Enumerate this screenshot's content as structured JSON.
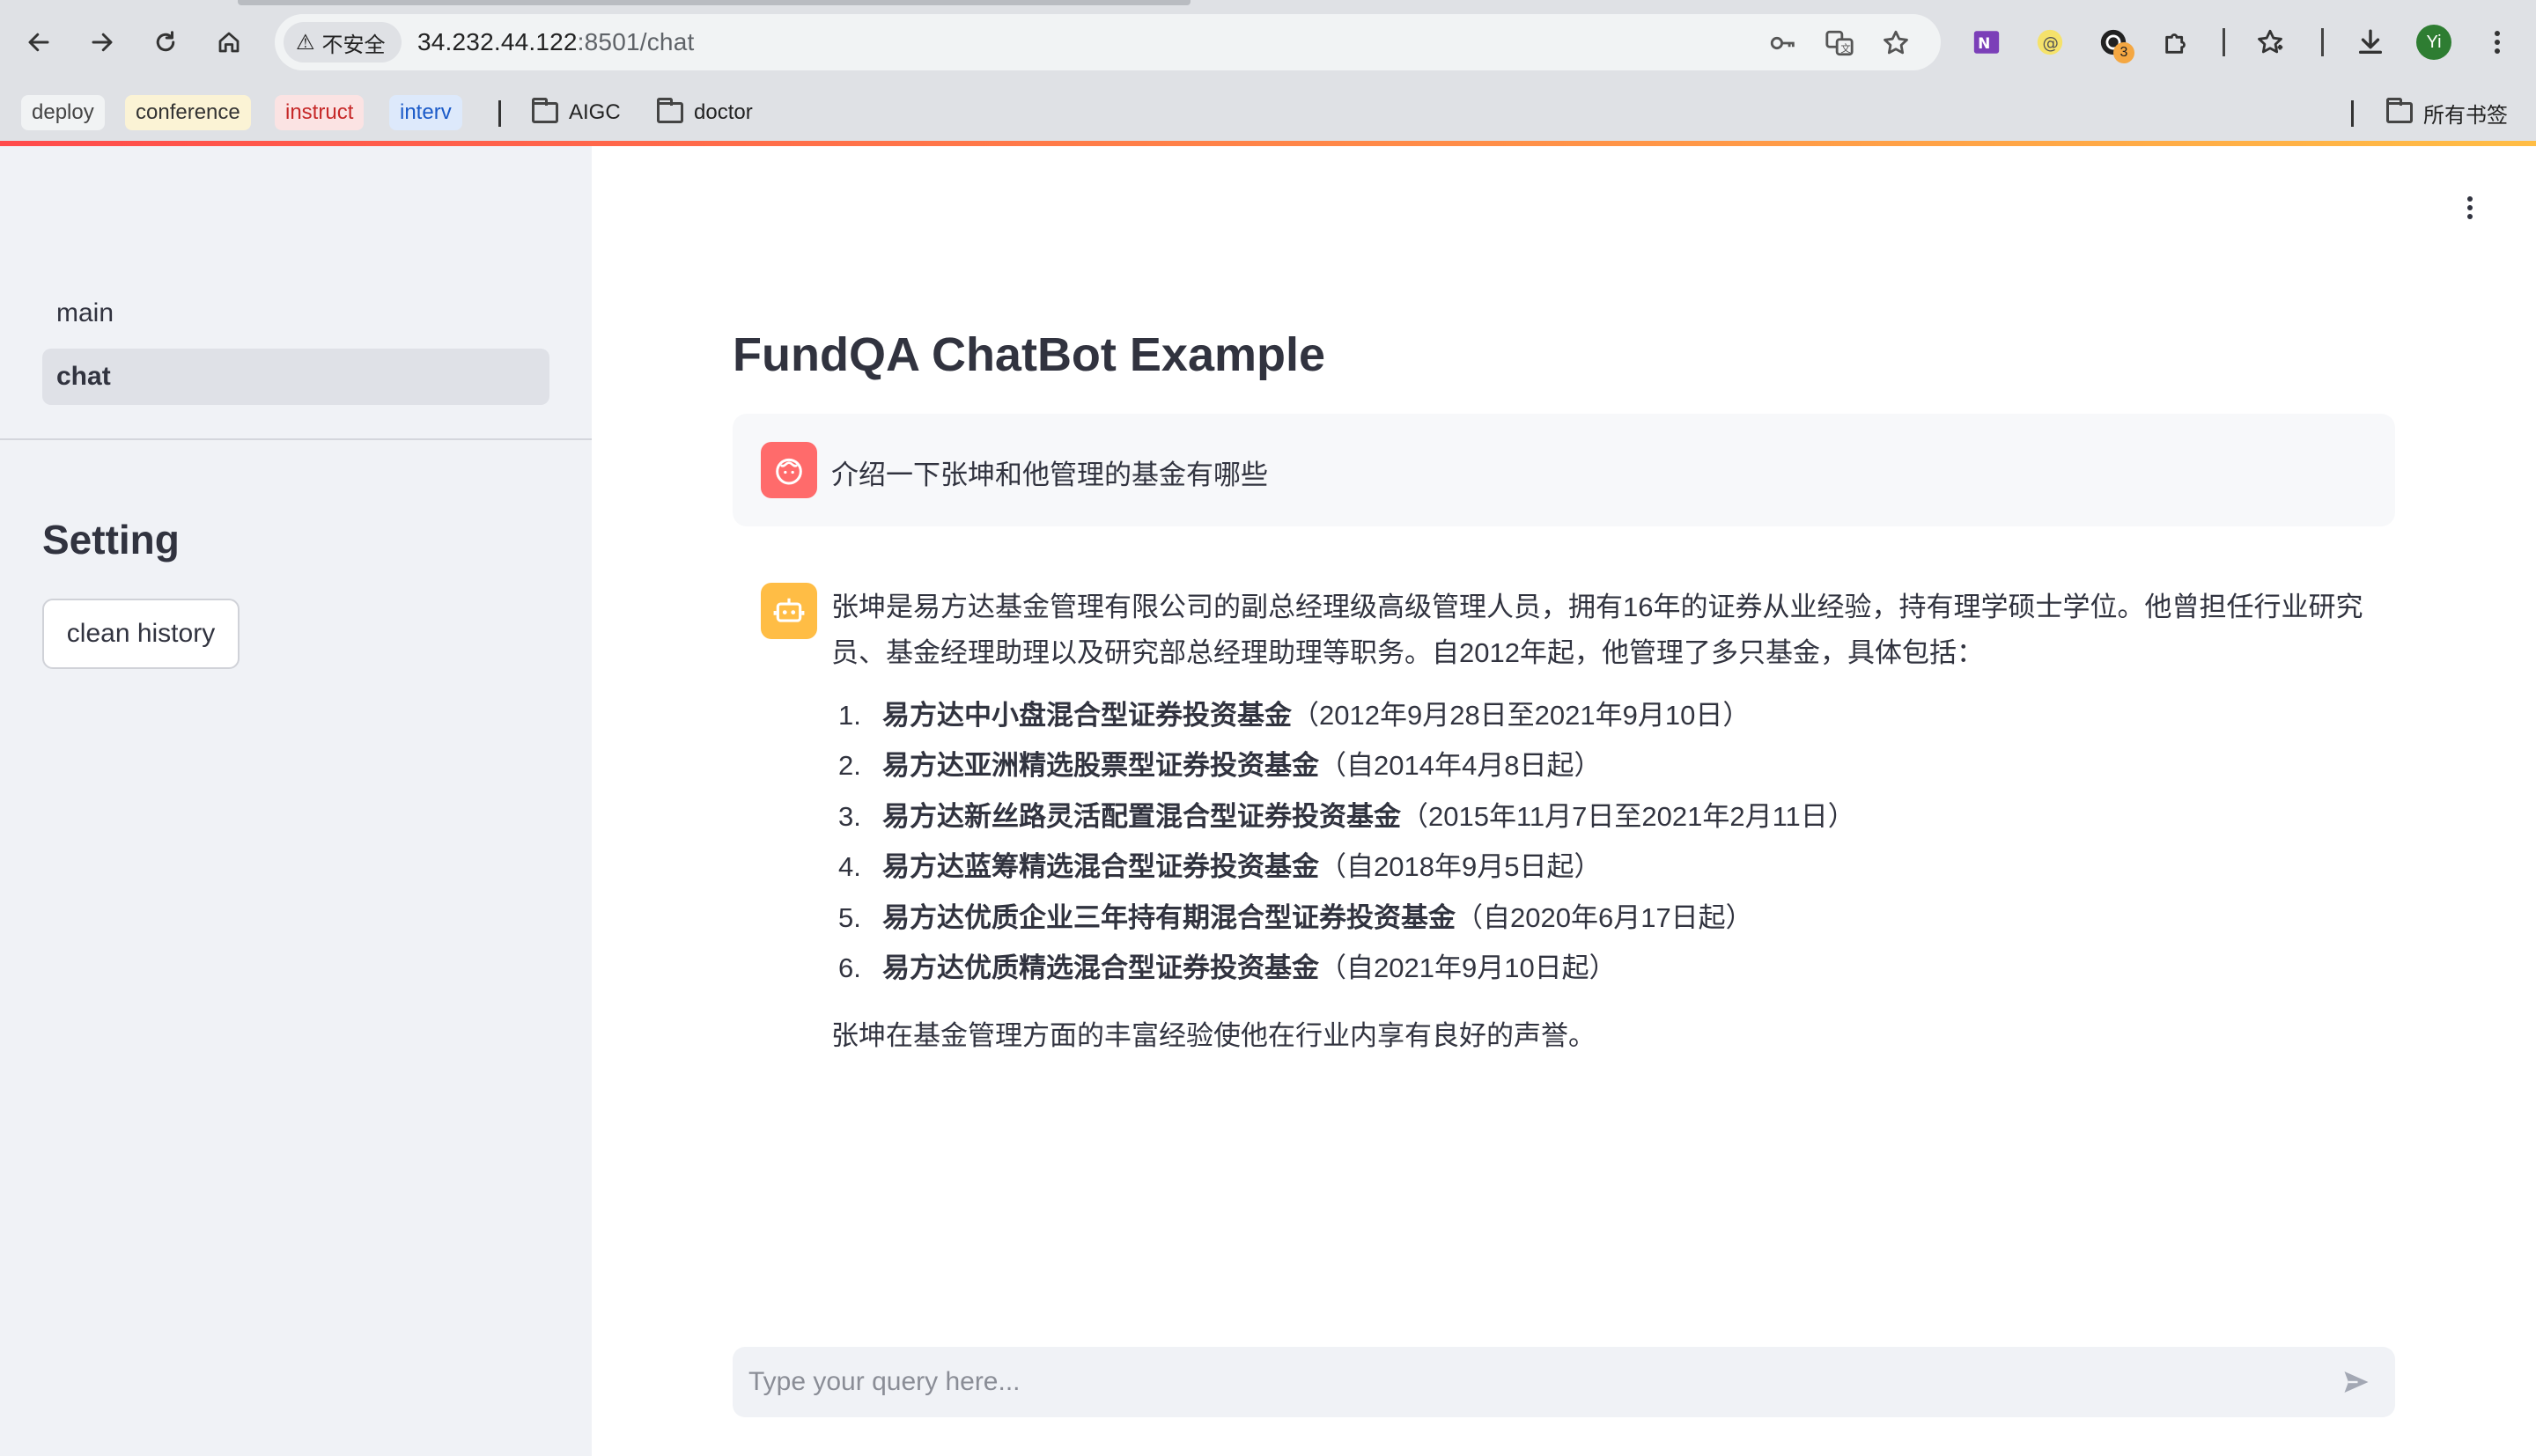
{
  "browser": {
    "security_label": "不安全",
    "url_host": "34.232.44.122",
    "url_rest": ":8501/chat",
    "extension_badge": "3",
    "profile_initial": "Yi",
    "bookmarks": {
      "tags": [
        "deploy",
        "conference",
        "instruct",
        "interv"
      ],
      "folders": [
        "AIGC",
        "doctor"
      ],
      "all_bookmarks": "所有书签"
    }
  },
  "sidebar": {
    "nav_items": [
      "main",
      "chat"
    ],
    "active_item": "chat",
    "setting_title": "Setting",
    "clean_button": "clean history"
  },
  "main": {
    "title": "FundQA ChatBot Example",
    "user_message": "介绍一下张坤和他管理的基金有哪些",
    "bot_intro": "张坤是易方达基金管理有限公司的副总经理级高级管理人员，拥有16年的证券从业经验，持有理学硕士学位。他曾担任行业研究员、基金经理助理以及研究部总经理助理等职务。自2012年起，他管理了多只基金，具体包括：",
    "funds": [
      {
        "num": "1.",
        "name": "易方达中小盘混合型证券投资基金",
        "period": "（2012年9月28日至2021年9月10日）"
      },
      {
        "num": "2.",
        "name": "易方达亚洲精选股票型证券投资基金",
        "period": "（自2014年4月8日起）"
      },
      {
        "num": "3.",
        "name": "易方达新丝路灵活配置混合型证券投资基金",
        "period": "（2015年11月7日至2021年2月11日）"
      },
      {
        "num": "4.",
        "name": "易方达蓝筹精选混合型证券投资基金",
        "period": "（自2018年9月5日起）"
      },
      {
        "num": "5.",
        "name": "易方达优质企业三年持有期混合型证券投资基金",
        "period": "（自2020年6月17日起）"
      },
      {
        "num": "6.",
        "name": "易方达优质精选混合型证券投资基金",
        "period": "（自2021年9月10日起）"
      }
    ],
    "bot_closing": "张坤在基金管理方面的丰富经验使他在行业内享有良好的声誉。",
    "input_placeholder": "Type your query here..."
  },
  "colors": {
    "accent_red": "#ff4b4b",
    "accent_yellow": "#ffbd45",
    "sidebar_bg": "#f0f2f6",
    "text": "#31333f"
  }
}
